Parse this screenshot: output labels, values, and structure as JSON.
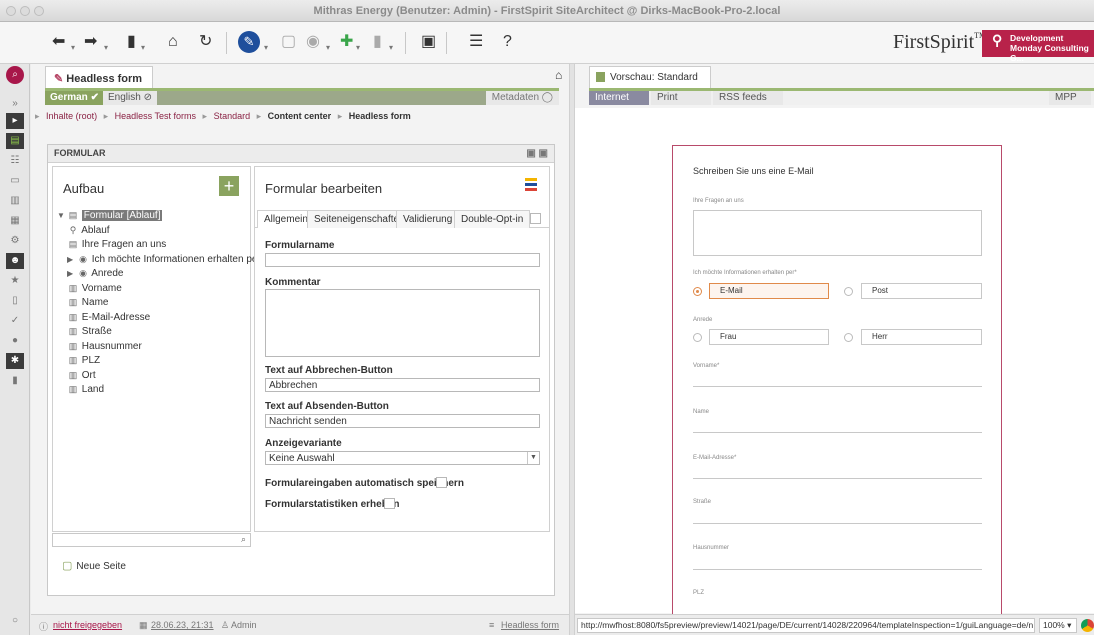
{
  "window": {
    "title": "Mithras Energy (Benutzer: Admin) - FirstSpirit SiteArchitect @ Dirks-MacBook-Pro-2.local"
  },
  "toolbar": {
    "logo_text": "FirstSpirit",
    "logo_tm": "TM",
    "dev_line1": "Development",
    "dev_line2": "Monday Consulting G...",
    "accent": "#b8224a"
  },
  "editor": {
    "tab_label": "Headless form",
    "langs": [
      "German",
      "English"
    ],
    "metadaten": "Metadaten",
    "breadcrumb": [
      "Inhalte (root)",
      "Headless Test forms",
      "Standard",
      "Content center",
      "Headless form"
    ],
    "formular_header": "FORMULAR",
    "aufbau_title": "Aufbau",
    "tree": [
      {
        "label": "Formular [Ablauf]",
        "icon": "form-icon"
      },
      {
        "label": "Ablauf",
        "icon": "flow-icon"
      },
      {
        "label": "Ihre Fragen an uns",
        "icon": "textarea-icon"
      },
      {
        "label": "Ich möchte Informationen erhalten per",
        "icon": "radio-icon"
      },
      {
        "label": "Anrede",
        "icon": "radio-icon"
      },
      {
        "label": "Vorname",
        "icon": "textfield-icon"
      },
      {
        "label": "Name",
        "icon": "textfield-icon"
      },
      {
        "label": "E-Mail-Adresse",
        "icon": "textfield-icon"
      },
      {
        "label": "Straße",
        "icon": "textfield-icon"
      },
      {
        "label": "Hausnummer",
        "icon": "textfield-icon"
      },
      {
        "label": "PLZ",
        "icon": "textfield-icon"
      },
      {
        "label": "Ort",
        "icon": "textfield-icon"
      },
      {
        "label": "Land",
        "icon": "textfield-icon"
      }
    ],
    "neue_seite": "Neue Seite",
    "edit_title": "Formular bearbeiten",
    "edit_tabs": [
      "Allgemein",
      "Seiteneigenschaften",
      "Validierung",
      "Double-Opt-in"
    ],
    "fields": {
      "formularname_label": "Formularname",
      "formularname_value": "",
      "kommentar_label": "Kommentar",
      "abbrechen_label": "Text auf Abbrechen-Button",
      "abbrechen_value": "Abbrechen",
      "absenden_label": "Text auf Absenden-Button",
      "absenden_value": "Nachricht senden",
      "anzeige_label": "Anzeigevariante",
      "anzeige_value": "Keine Auswahl",
      "auto_save_label": "Formulareingaben automatisch speichern",
      "stats_label": "Formularstatistiken erheben"
    }
  },
  "preview": {
    "tab_label": "Vorschau: Standard",
    "buttons": [
      "Internet",
      "Print",
      "RSS feeds"
    ],
    "mpp": "MPP",
    "form": {
      "title": "Schreiben Sie uns eine E-Mail",
      "fragen_label": "Ihre Fragen an uns",
      "info_label": "Ich möchte Informationen erhalten per*",
      "info_options": [
        "E-Mail",
        "Post"
      ],
      "anrede_label": "Anrede",
      "anrede_options": [
        "Frau",
        "Herr"
      ],
      "vorname_label": "Vorname*",
      "name_label": "Name",
      "email_label": "E-Mail-Adresse*",
      "strasse_label": "Straße",
      "hausnummer_label": "Hausnummer",
      "plz_label": "PLZ"
    }
  },
  "status": {
    "release": "nicht freigegeben",
    "date": "28.06.23, 21:31",
    "user": "Admin",
    "doc": "Headless form"
  },
  "browser": {
    "url": "http://mwfhost:8080/fs5preview/preview/14021/page/DE/current/14028/220964/templateInspection=1/guiLanguage=de/n",
    "zoom": "100%"
  }
}
